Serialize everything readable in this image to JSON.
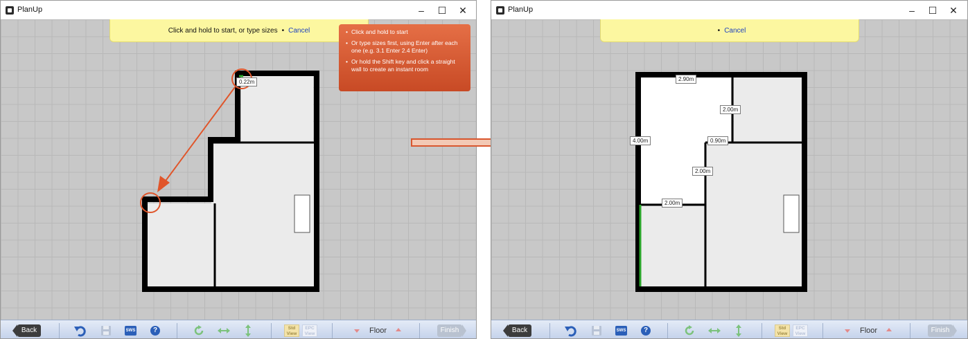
{
  "app": {
    "title": "PlanUp"
  },
  "window_controls": {
    "minimize": "–",
    "maximize": "☐",
    "close": "✕"
  },
  "left": {
    "prompt": {
      "text": "Click and hold to start, or type sizes",
      "separator": "•",
      "cancel": "Cancel"
    },
    "tips": [
      "Click and hold to start",
      "Or type sizes first, using Enter after each one (e.g. 3.1 Enter 2.4 Enter)",
      "Or hold the Shift key and click a straight wall to create an instant room"
    ],
    "dimension_label": "0.22m"
  },
  "right": {
    "prompt": {
      "separator": "•",
      "cancel": "Cancel"
    },
    "dimension_labels": [
      "2.90m",
      "2.00m",
      "4.00m",
      "0.90m",
      "2.00m",
      "2.00m"
    ]
  },
  "toolbar": {
    "back": "Back",
    "sws": "SWS",
    "help": "?",
    "std_view": [
      "Std",
      "View"
    ],
    "epc_view": [
      "EPC",
      "View"
    ],
    "floor": "Floor",
    "finish": "Finish"
  },
  "colors": {
    "canvas": "#c8c8c8",
    "wall": "#000000",
    "room_fill": "#ebebeb",
    "prompt_bg": "#fcf7a0",
    "tip_bg": "#d9572f",
    "annotation": "#e0552a",
    "active_wall": "#2aa52a",
    "cancel_link": "#1a3fbf"
  },
  "icons": [
    "app-logo-icon",
    "undo-icon",
    "save-icon",
    "sws-icon",
    "help-icon",
    "rotate-icon",
    "flip-horizontal-icon",
    "flip-vertical-icon",
    "floor-down-icon",
    "floor-up-icon"
  ]
}
